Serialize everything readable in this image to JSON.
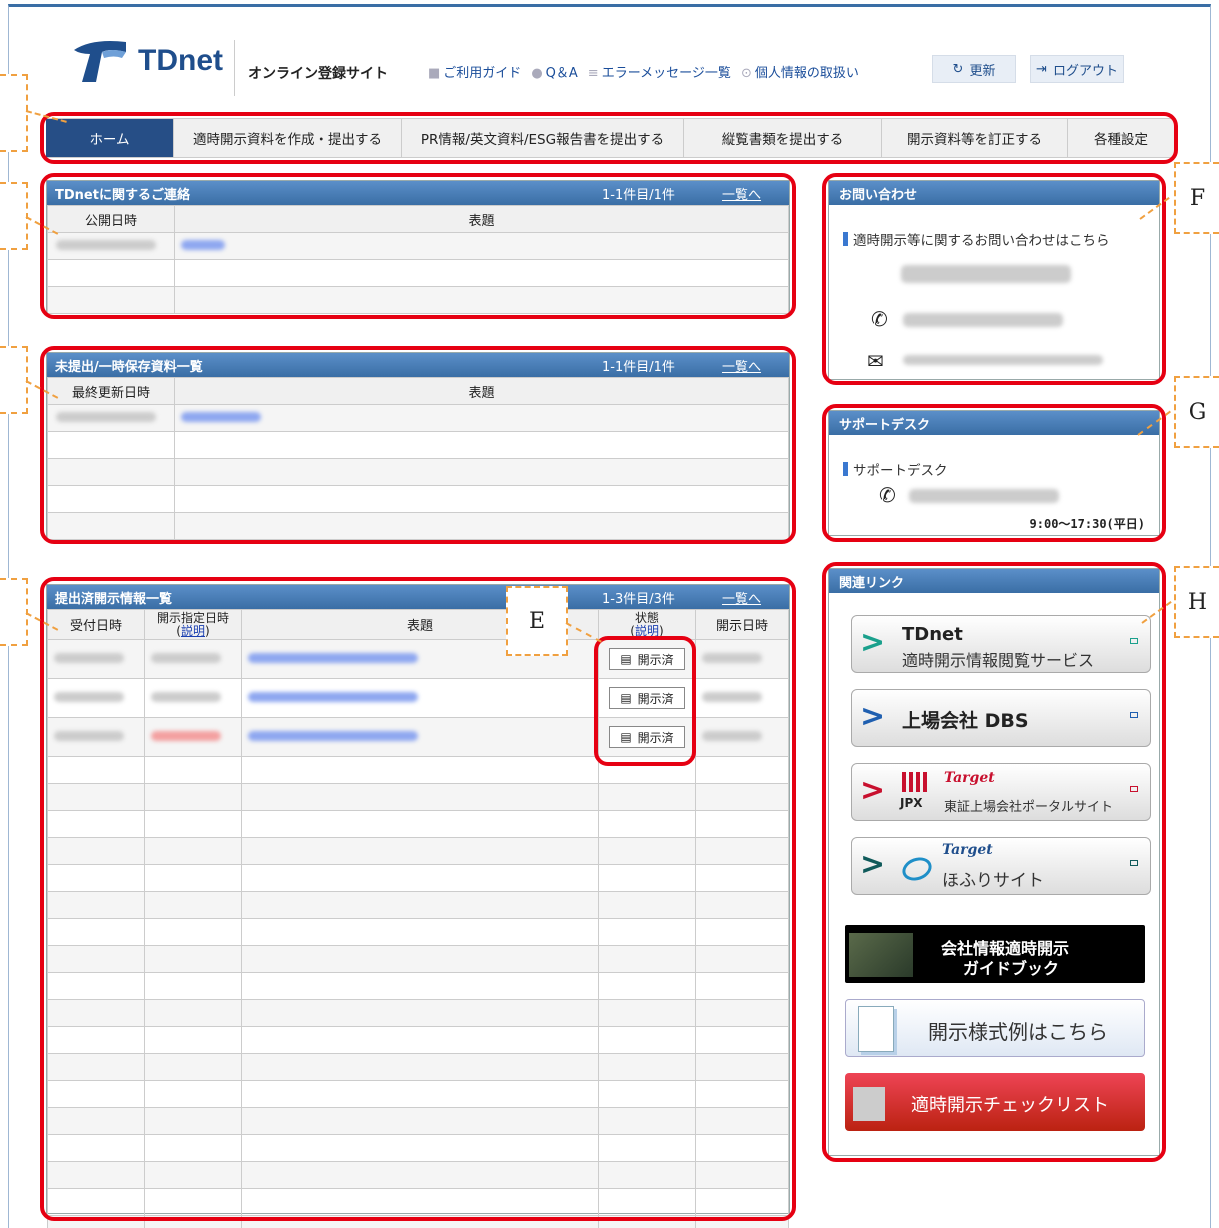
{
  "header": {
    "logo_text": "TDnet",
    "site_name": "オンライン登録サイト",
    "links": [
      "ご利用ガイド",
      "Q＆A",
      "エラーメッセージ一覧",
      "個人情報の取扱い"
    ],
    "refresh_label": "更新",
    "logout_label": "ログアウト"
  },
  "nav": {
    "items": [
      "ホーム",
      "適時開示資料を作成・提出する",
      "PR情報/英文資料/ESG報告書を提出する",
      "縦覧書類を提出する",
      "開示資料等を訂正する",
      "各種設定"
    ]
  },
  "contact_panel": {
    "title": "TDnetに関するご連絡",
    "count": "1-1件目/1件",
    "more": "一覧へ",
    "col1": "公開日時",
    "col2": "表題"
  },
  "draft_panel": {
    "title": "未提出/一時保存資料一覧",
    "count": "1-1件目/1件",
    "more": "一覧へ",
    "col1": "最終更新日時",
    "col2": "表題"
  },
  "submitted_panel": {
    "title": "提出済開示情報一覧",
    "count": "1-3件目/3件",
    "more": "一覧へ",
    "col_received": "受付日時",
    "col_specified": "開示指定日時",
    "col_specified_link": "説明",
    "col_title": "表題",
    "col_status": "状態",
    "col_status_link": "説明",
    "col_disclosed": "開示日時",
    "status_label": "開示済"
  },
  "inquiry": {
    "title": "お問い合わせ",
    "text": "適時開示等に関するお問い合わせはこちら"
  },
  "support": {
    "title": "サポートデスク",
    "label": "サポートデスク",
    "hours": "9:00～17:30(平日)"
  },
  "links": {
    "title": "関連リンク",
    "tdnet_brand": "TDnet",
    "tdnet_sub": "適時開示情報閲覧サービス",
    "dbs": "上場会社 DBS",
    "jpx_mark": "JPX",
    "target": "Target",
    "jpx_portal": "東証上場会社ポータルサイト",
    "hofuri": "ほふりサイト",
    "guidebook": [
      "会社情報適時開示",
      "ガイドブック"
    ],
    "format_examples": "開示様式例はこちら",
    "checklist": "適時開示チェックリスト"
  },
  "callouts": [
    "E",
    "F",
    "G",
    "H"
  ],
  "colors": {
    "accent": "#3a6ea5",
    "nav_active": "#264e86",
    "highlight": "#e60012",
    "callout": "#f0a040"
  }
}
